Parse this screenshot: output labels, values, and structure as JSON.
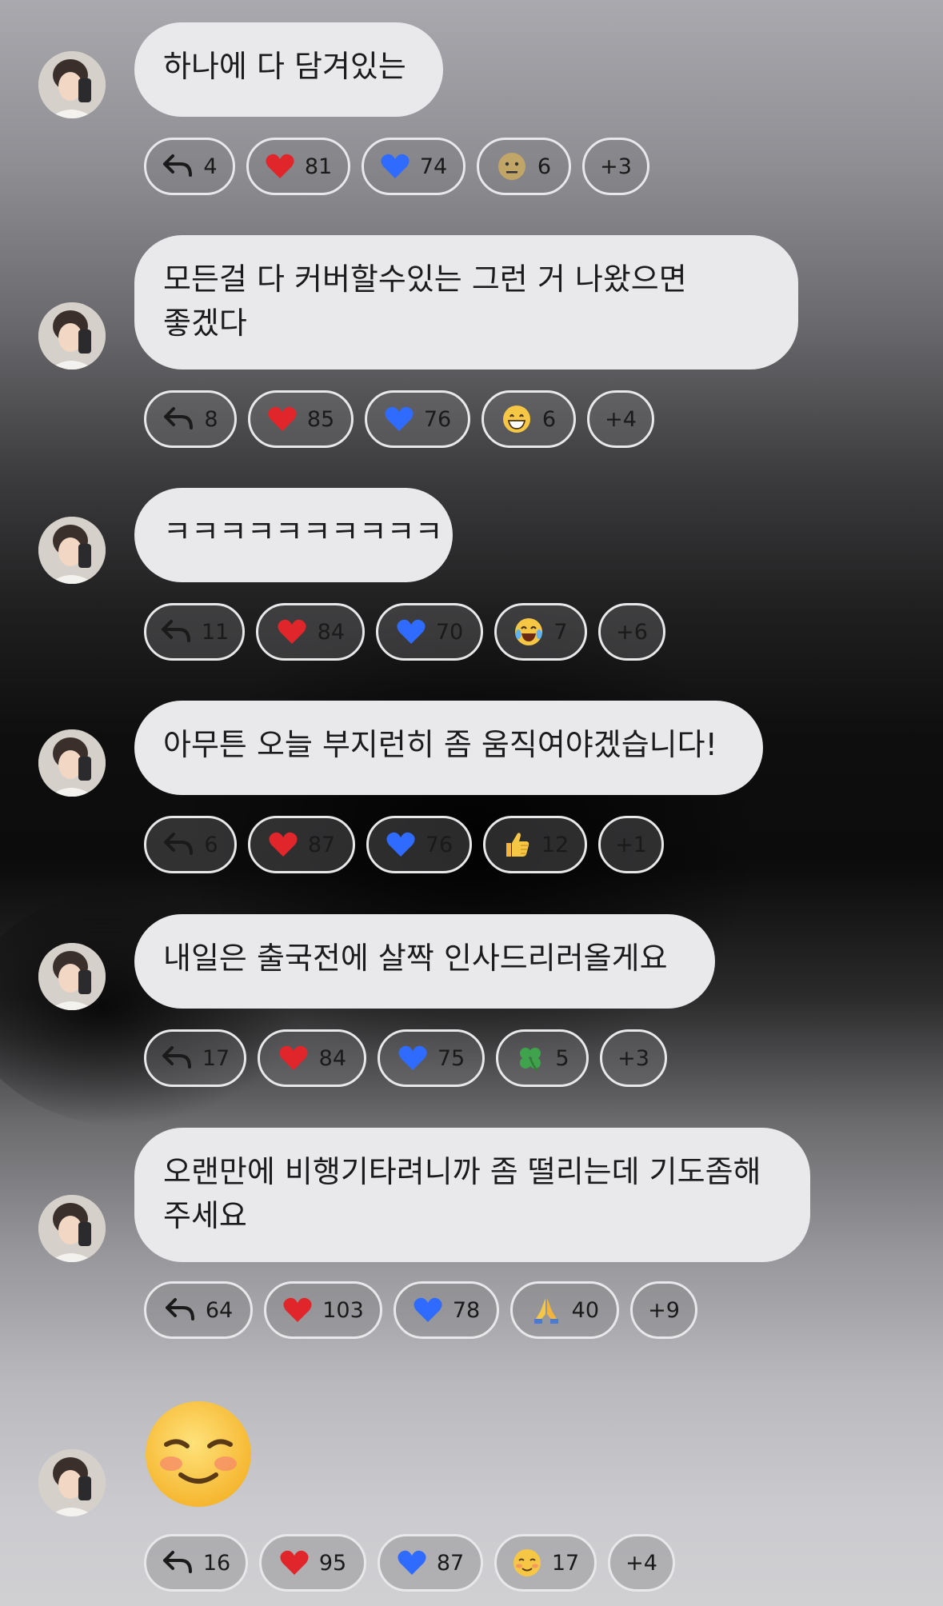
{
  "messages": [
    {
      "text": "하나에 다 담겨있는",
      "reactions": {
        "reply": "4",
        "red_heart": "81",
        "blue_heart": "74",
        "extra_emoji": "neutral-face",
        "extra_count": "6",
        "more": "+3"
      }
    },
    {
      "text": "모든걸 다 커버할수있는 그런 거 나왔으면 좋겠다",
      "reactions": {
        "reply": "8",
        "red_heart": "85",
        "blue_heart": "76",
        "extra_emoji": "grinning-face",
        "extra_count": "6",
        "more": "+4"
      }
    },
    {
      "text": "ㅋㅋㅋㅋㅋㅋㅋㅋㅋㅋ",
      "reactions": {
        "reply": "11",
        "red_heart": "84",
        "blue_heart": "70",
        "extra_emoji": "tears-of-joy-face",
        "extra_count": "7",
        "more": "+6"
      }
    },
    {
      "text": "아무튼 오늘 부지런히 좀 움직여야겠습니다!",
      "reactions": {
        "reply": "6",
        "red_heart": "87",
        "blue_heart": "76",
        "extra_emoji": "thumbs-up",
        "extra_count": "12",
        "more": "+1"
      }
    },
    {
      "text": "내일은 출국전에 살짝 인사드리러올게요",
      "reactions": {
        "reply": "17",
        "red_heart": "84",
        "blue_heart": "75",
        "extra_emoji": "four-leaf-clover",
        "extra_count": "5",
        "more": "+3"
      }
    },
    {
      "text": "오랜만에 비행기타려니까 좀 떨리는데 기도좀해\n주세요",
      "reactions": {
        "reply": "64",
        "red_heart": "103",
        "blue_heart": "78",
        "extra_emoji": "folded-hands",
        "extra_count": "40",
        "more": "+9"
      }
    },
    {
      "emoji_message": "smiling-face",
      "reactions": {
        "reply": "16",
        "red_heart": "95",
        "blue_heart": "87",
        "extra_emoji": "smiling-face",
        "extra_count": "17",
        "more": "+4"
      }
    }
  ],
  "colors": {
    "bubble": "#e9e9eb",
    "chip_border": "#e8e8ea",
    "red_heart": "#e0262b",
    "blue_heart": "#2f6bff"
  }
}
